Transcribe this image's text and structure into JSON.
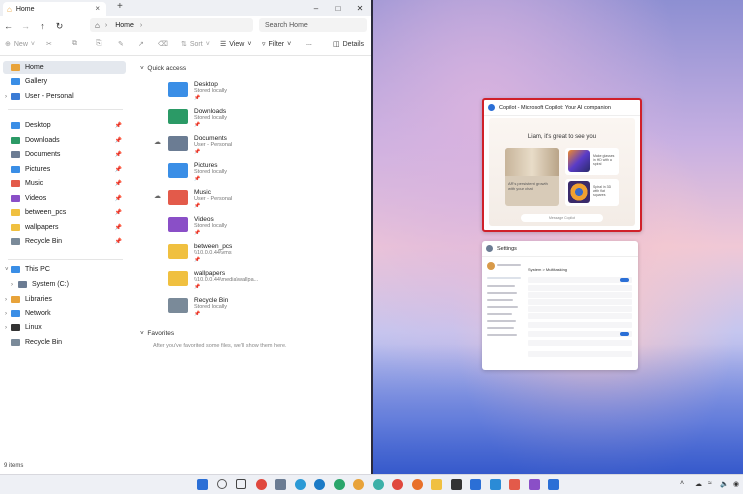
{
  "explorer": {
    "tab_title": "Home",
    "address_location": "Home",
    "search_placeholder": "Search Home",
    "toolbar": {
      "new_label": "New",
      "sort_label": "Sort",
      "view_label": "View",
      "filter_label": "Filter",
      "more_label": "...",
      "details_label": "Details"
    },
    "sidebar": {
      "top": [
        {
          "label": "Home",
          "icon": "home-icon",
          "color": "#e8a33a"
        },
        {
          "label": "Gallery",
          "icon": "gallery-icon",
          "color": "#3a8ee6"
        },
        {
          "label": "User - Personal",
          "icon": "cloud-icon",
          "color": "#3a7bd5"
        }
      ],
      "pinned": [
        {
          "label": "Desktop",
          "icon": "desktop-icon",
          "color": "#3a8ee6"
        },
        {
          "label": "Downloads",
          "icon": "downloads-icon",
          "color": "#2b9a66"
        },
        {
          "label": "Documents",
          "icon": "documents-icon",
          "color": "#6b7c93"
        },
        {
          "label": "Pictures",
          "icon": "pictures-icon",
          "color": "#3a8ee6"
        },
        {
          "label": "Music",
          "icon": "music-icon",
          "color": "#e35a4a"
        },
        {
          "label": "Videos",
          "icon": "videos-icon",
          "color": "#8a4fc7"
        },
        {
          "label": "between_pcs",
          "icon": "folder-icon",
          "color": "#f0c040"
        },
        {
          "label": "wallpapers",
          "icon": "folder-icon",
          "color": "#f0c040"
        },
        {
          "label": "Recycle Bin",
          "icon": "recycle-bin-icon",
          "color": "#7a8a99"
        }
      ],
      "bottom": [
        {
          "label": "This PC",
          "icon": "pc-icon",
          "color": "#3a8ee6"
        },
        {
          "label": "System (C:)",
          "icon": "drive-icon",
          "color": "#6b7c93"
        },
        {
          "label": "Libraries",
          "icon": "libraries-icon",
          "color": "#e8a33a"
        },
        {
          "label": "Network",
          "icon": "network-icon",
          "color": "#3a8ee6"
        },
        {
          "label": "Linux",
          "icon": "linux-icon",
          "color": "#333333"
        },
        {
          "label": "Recycle Bin",
          "icon": "recycle-bin-icon",
          "color": "#7a8a99"
        }
      ]
    },
    "quick_access": {
      "heading": "Quick access",
      "items": [
        {
          "name": "Desktop",
          "sub": "Stored locally",
          "cloud": false,
          "color": "#3a8ee6"
        },
        {
          "name": "Downloads",
          "sub": "Stored locally",
          "cloud": false,
          "color": "#2b9a66"
        },
        {
          "name": "Documents",
          "sub": "User - Personal",
          "cloud": true,
          "color": "#6b7c93"
        },
        {
          "name": "Pictures",
          "sub": "Stored locally",
          "cloud": false,
          "color": "#3a8ee6"
        },
        {
          "name": "Music",
          "sub": "User - Personal",
          "cloud": true,
          "color": "#e35a4a"
        },
        {
          "name": "Videos",
          "sub": "Stored locally",
          "cloud": false,
          "color": "#8a4fc7"
        },
        {
          "name": "between_pcs",
          "sub": "\\\\10.0.0.44\\vms",
          "cloud": false,
          "color": "#f0c040"
        },
        {
          "name": "wallpapers",
          "sub": "\\\\10.0.0.44\\media\\wallpa...",
          "cloud": false,
          "color": "#f0c040"
        },
        {
          "name": "Recycle Bin",
          "sub": "Stored locally",
          "cloud": false,
          "color": "#7a8a99"
        }
      ]
    },
    "favorites": {
      "heading": "Favorites",
      "empty_text": "After you've favorited some files, we'll show them here."
    },
    "status_text": "9 items"
  },
  "snap": {
    "copilot": {
      "title": "Copilot - Microsoft Copilot: Your AI companion",
      "greeting": "Liam, it's great to see you",
      "card1_text": "AR's persistent growth with your chat",
      "card2_text": "Make glasses in HD with a spiral",
      "card3_text": "Spiral in 3D with flat squares",
      "input_placeholder": "Message Copilot"
    },
    "settings": {
      "title": "Settings",
      "breadcrumb": "System > Multitasking"
    }
  },
  "taskbar": {
    "tray_time": "",
    "apps": [
      {
        "name": "start-icon",
        "color": "#2b6fd6"
      },
      {
        "name": "search-icon",
        "color": "#555555"
      },
      {
        "name": "task-view-icon",
        "color": "#444444"
      },
      {
        "name": "chrome-icon",
        "color": "#e0483e"
      },
      {
        "name": "settings-icon",
        "color": "#6b7c93"
      },
      {
        "name": "edge-icon",
        "color": "#2b9ad6"
      },
      {
        "name": "edge-beta-icon",
        "color": "#1b7ac6"
      },
      {
        "name": "edge-dev-icon",
        "color": "#2aa56b"
      },
      {
        "name": "edge-canary-icon",
        "color": "#e8a33a"
      },
      {
        "name": "copilot-icon",
        "color": "#3cb0a8"
      },
      {
        "name": "chrome-2-icon",
        "color": "#e0483e"
      },
      {
        "name": "firefox-icon",
        "color": "#e8702a"
      },
      {
        "name": "file-explorer-icon",
        "color": "#f0c040"
      },
      {
        "name": "terminal-icon",
        "color": "#333333"
      },
      {
        "name": "store-icon",
        "color": "#2b6fd6"
      },
      {
        "name": "notepad-icon",
        "color": "#2b8bd6"
      },
      {
        "name": "paint-icon",
        "color": "#e35a4a"
      },
      {
        "name": "snipping-icon",
        "color": "#8a4fc7"
      },
      {
        "name": "copilot-2-icon",
        "color": "#2b6fd6"
      }
    ]
  }
}
